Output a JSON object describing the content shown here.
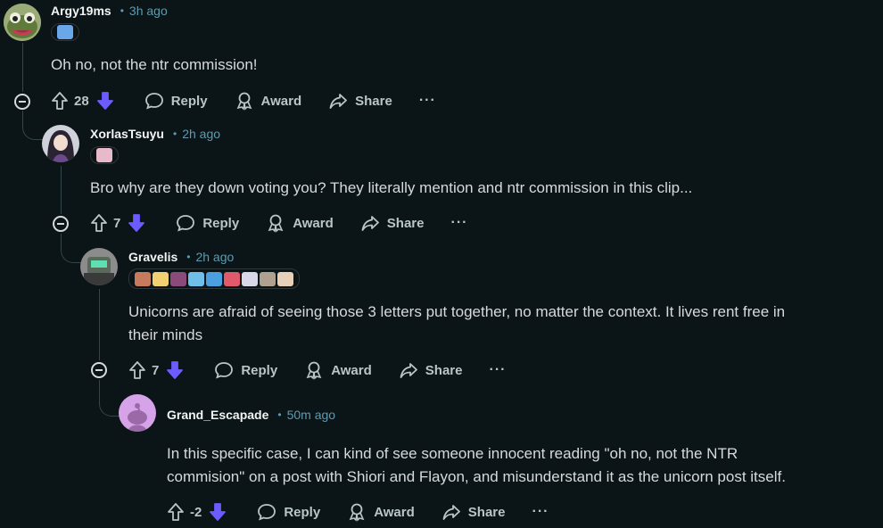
{
  "comments": [
    {
      "username": "Argy19ms",
      "time": "3h ago",
      "text": "Oh no, not the ntr commission!",
      "votes": "28",
      "avatar": "avatar-frog",
      "flair_colors": [
        "#6aa7e8"
      ]
    },
    {
      "username": "XorlasTsuyu",
      "time": "2h ago",
      "text": "Bro why are they down voting you? They literally mention and ntr commission in this clip...",
      "votes": "7",
      "avatar": "avatar-anime-girl",
      "flair_colors": [
        "#e8b9c8"
      ]
    },
    {
      "username": "Gravelis",
      "time": "2h ago",
      "text_line1": "Unicorns are afraid of seeing those 3 letters put together, no matter the context. It lives rent free in",
      "text_line2": "their minds",
      "votes": "7",
      "avatar": "avatar-robot",
      "flair_colors": [
        "#c77a5c",
        "#f0d070",
        "#8a4a7a",
        "#6fc0e8",
        "#4aa0e0",
        "#e05a6a",
        "#d8d8e8",
        "#b0a090",
        "#e8d0b8"
      ]
    },
    {
      "username": "Grand_Escapade",
      "time": "50m ago",
      "text_line1": "In this specific case, I can kind of see someone innocent reading \"oh no, not the NTR",
      "text_line2": "commision\" on a post with Shiori and Flayon, and misunderstand it as the unicorn post itself.",
      "votes": "-2",
      "avatar": "avatar-snoo"
    }
  ],
  "actions": {
    "reply": "Reply",
    "award": "Award",
    "share": "Share",
    "more": "···"
  },
  "colors": {
    "background": "#0b1416",
    "downvote_active": "#6a5cff",
    "time": "#5e9bb0",
    "thread_line": "#33464c"
  }
}
